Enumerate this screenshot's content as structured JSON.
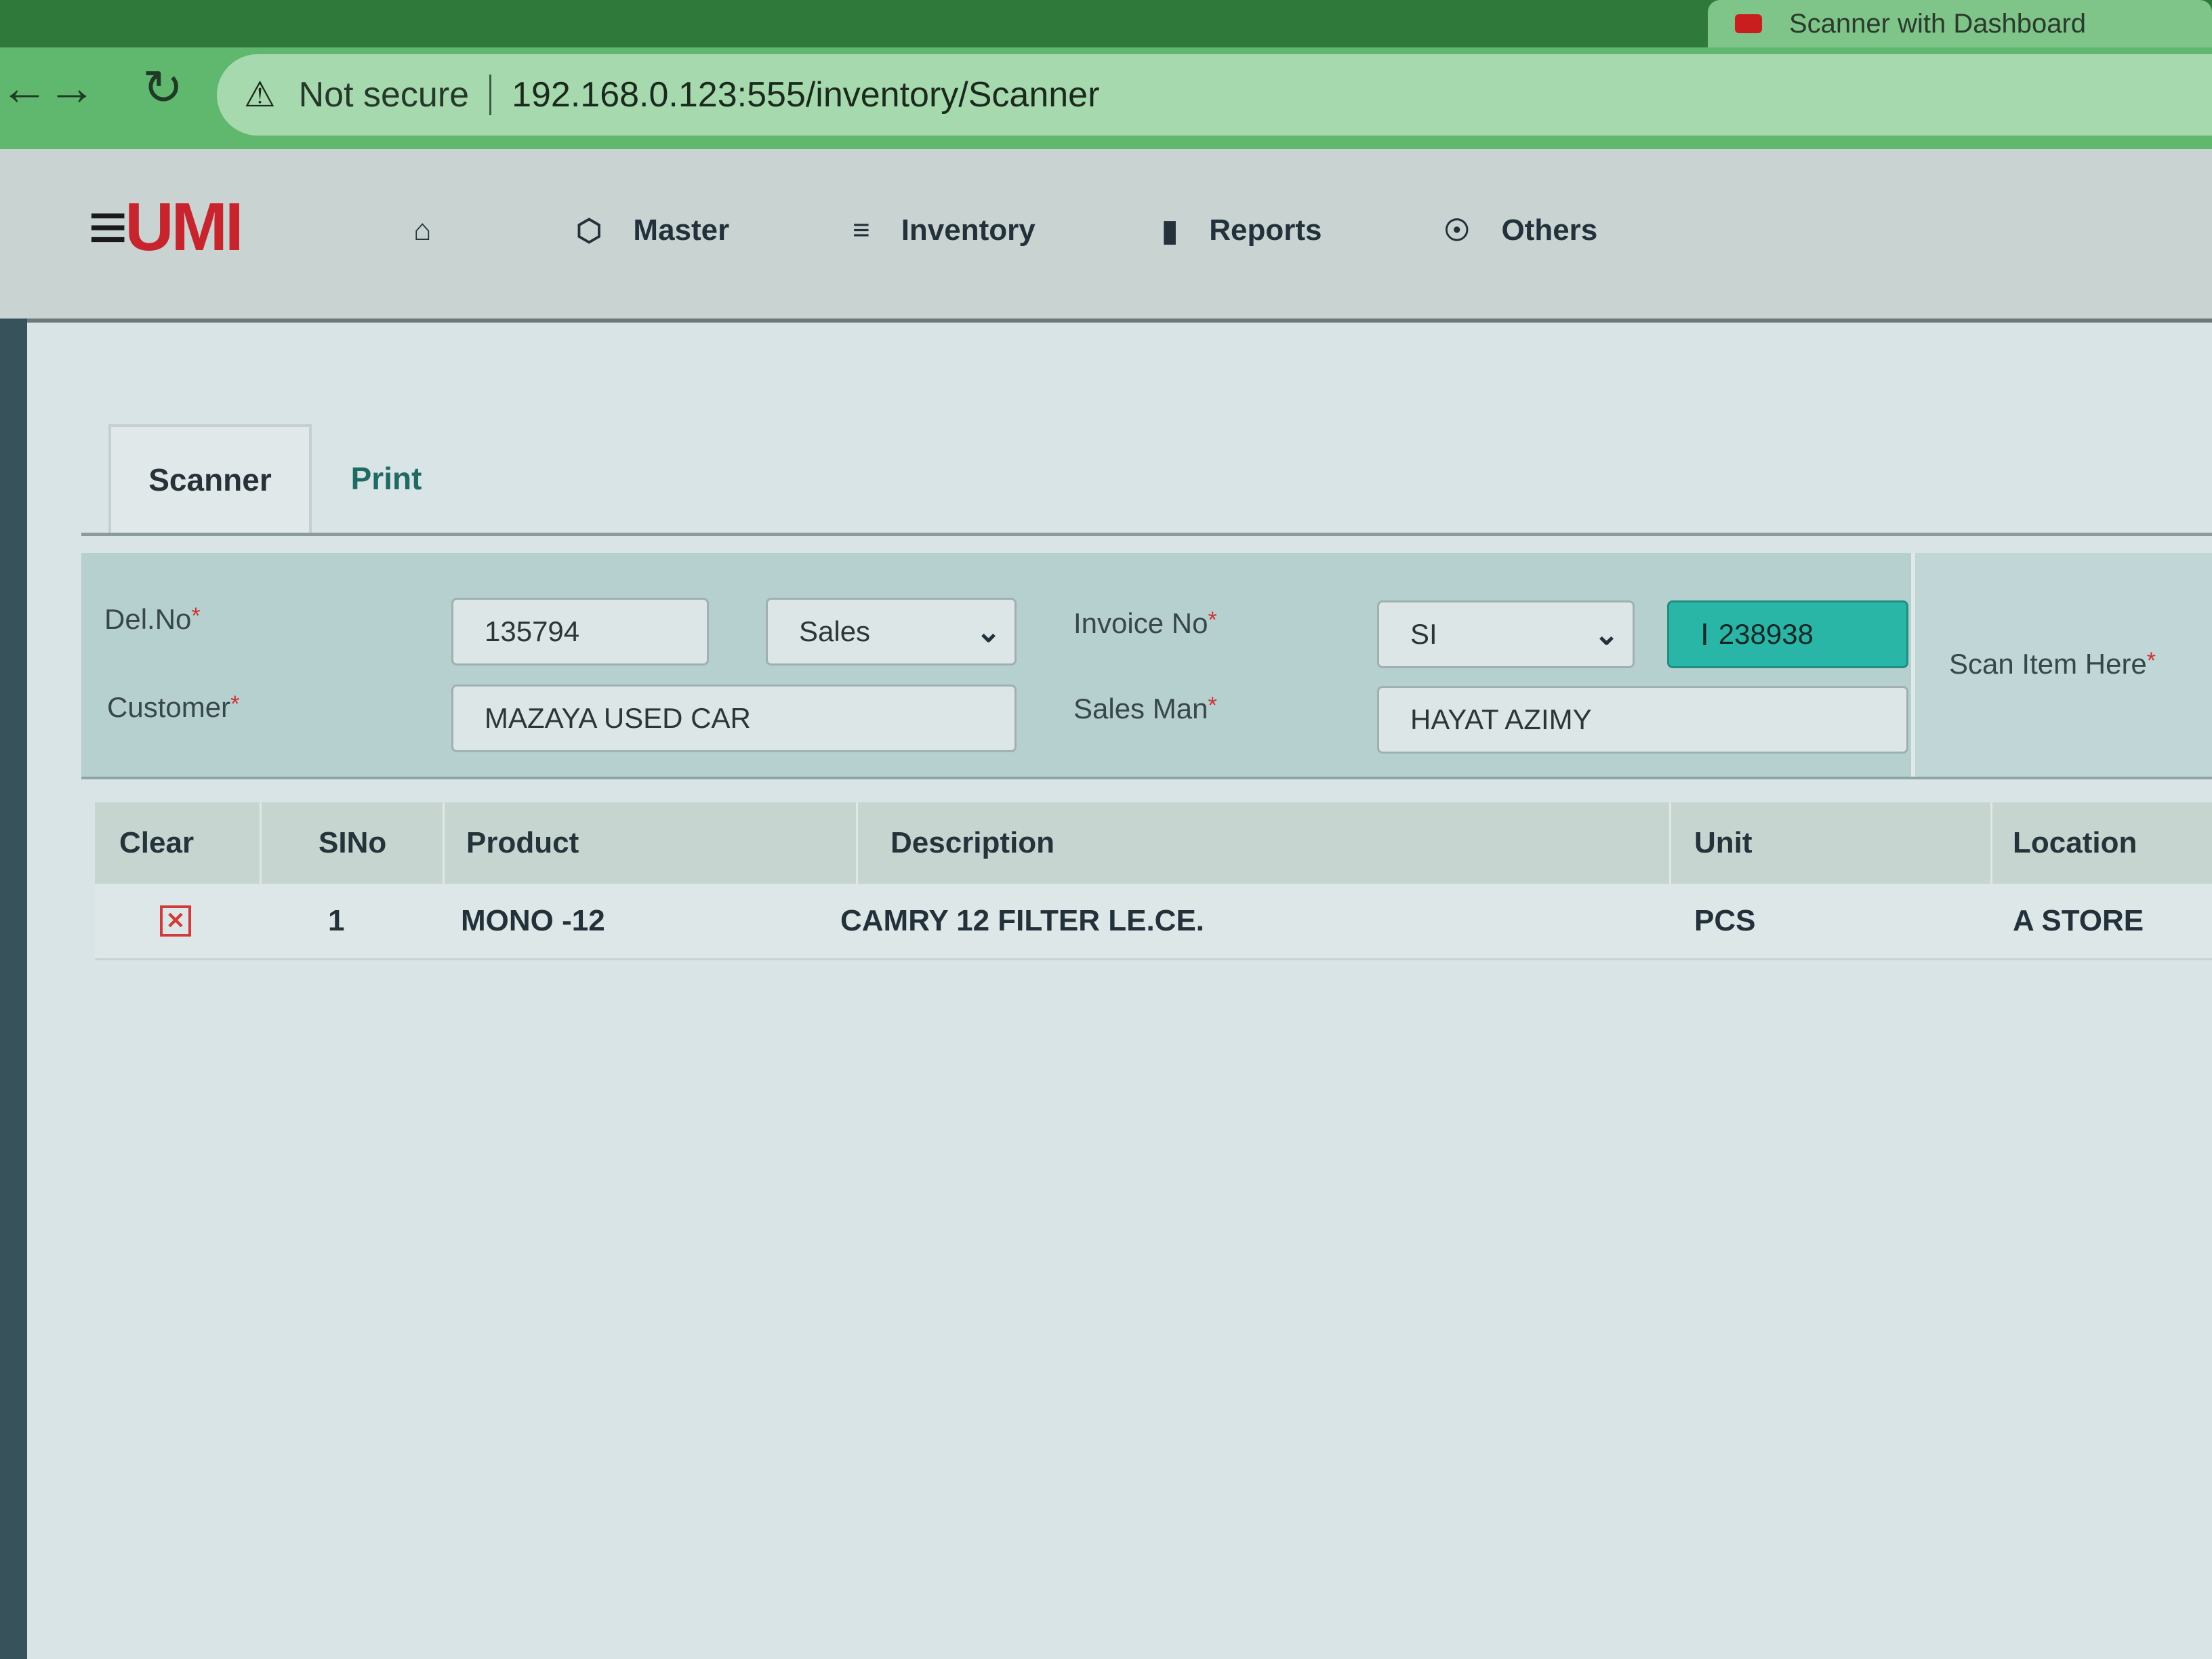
{
  "browser": {
    "tabs": [
      {
        "title": "Scanner with Dashboard",
        "active": true
      }
    ],
    "security_label": "Not secure",
    "url": "192.168.0.123:555/inventory/Scanner",
    "accent": "#5fb86e"
  },
  "app": {
    "logo_first": "≡",
    "logo_rest": "UMI",
    "nav": [
      {
        "label": "",
        "icon": "home-icon"
      },
      {
        "label": "Master",
        "icon": "cube-icon"
      },
      {
        "label": "Inventory",
        "icon": "layers-icon"
      },
      {
        "label": "Reports",
        "icon": "bar-chart-icon"
      },
      {
        "label": "Others",
        "icon": "globe-icon"
      }
    ]
  },
  "tabs": [
    {
      "label": "Scanner",
      "active": true
    },
    {
      "label": "Print",
      "active": false
    }
  ],
  "form": {
    "del_no_label": "Del.No",
    "del_no_value": "135794",
    "type_value": "Sales",
    "invoice_label": "Invoice No",
    "invoice_prefix": "SI",
    "invoice_value": "238938",
    "customer_label": "Customer",
    "customer_value": "MAZAYA USED CAR",
    "salesman_label": "Sales Man",
    "salesman_value": "HAYAT AZIMY",
    "scan_label": "Scan Item Here",
    "required_mark": "*"
  },
  "table": {
    "headers": [
      "Clear",
      "SINo",
      "Product",
      "Description",
      "Unit",
      "Location"
    ],
    "rows": [
      {
        "sino": "1",
        "product": "MONO -12",
        "description": "CAMRY 12 FILTER LE.CE.",
        "unit": "PCS",
        "location": "A STORE"
      }
    ]
  }
}
